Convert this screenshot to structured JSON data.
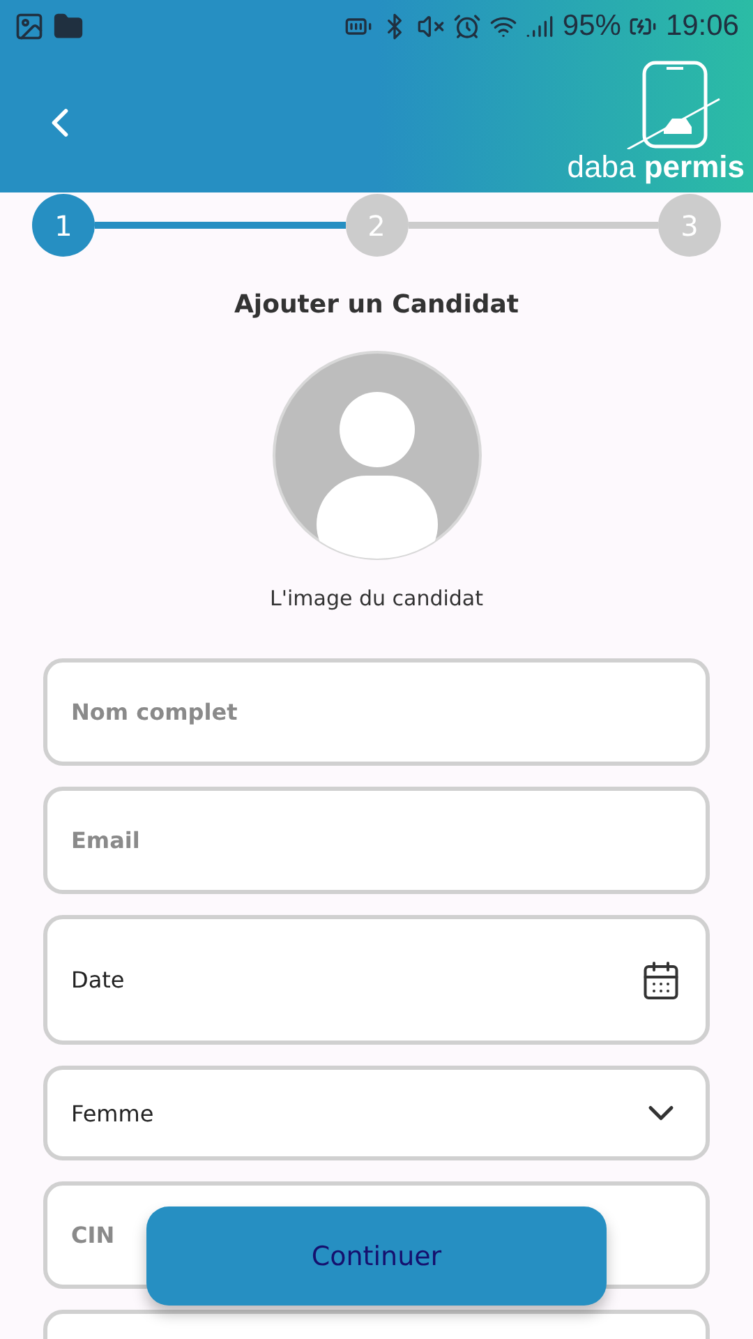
{
  "status_bar": {
    "battery": "95%",
    "time": "19:06"
  },
  "header": {
    "logo": "daba **permis**"
  },
  "steps": [
    {
      "label": "1",
      "active": true
    },
    {
      "label": "2",
      "active": false
    },
    {
      "label": "3",
      "active": false
    }
  ],
  "title": "Ajouter un Candidat",
  "photo": {
    "caption": "L'image du candidat"
  },
  "fields": [
    {
      "kind": "text",
      "placeholder": "Nom complet"
    },
    {
      "kind": "text",
      "placeholder": "Email"
    },
    {
      "kind": "date",
      "label": "Date"
    },
    {
      "kind": "select",
      "value": "Femme"
    },
    {
      "kind": "text",
      "placeholder": "CIN"
    },
    {
      "kind": "text"
    }
  ],
  "button": "Continuer"
}
